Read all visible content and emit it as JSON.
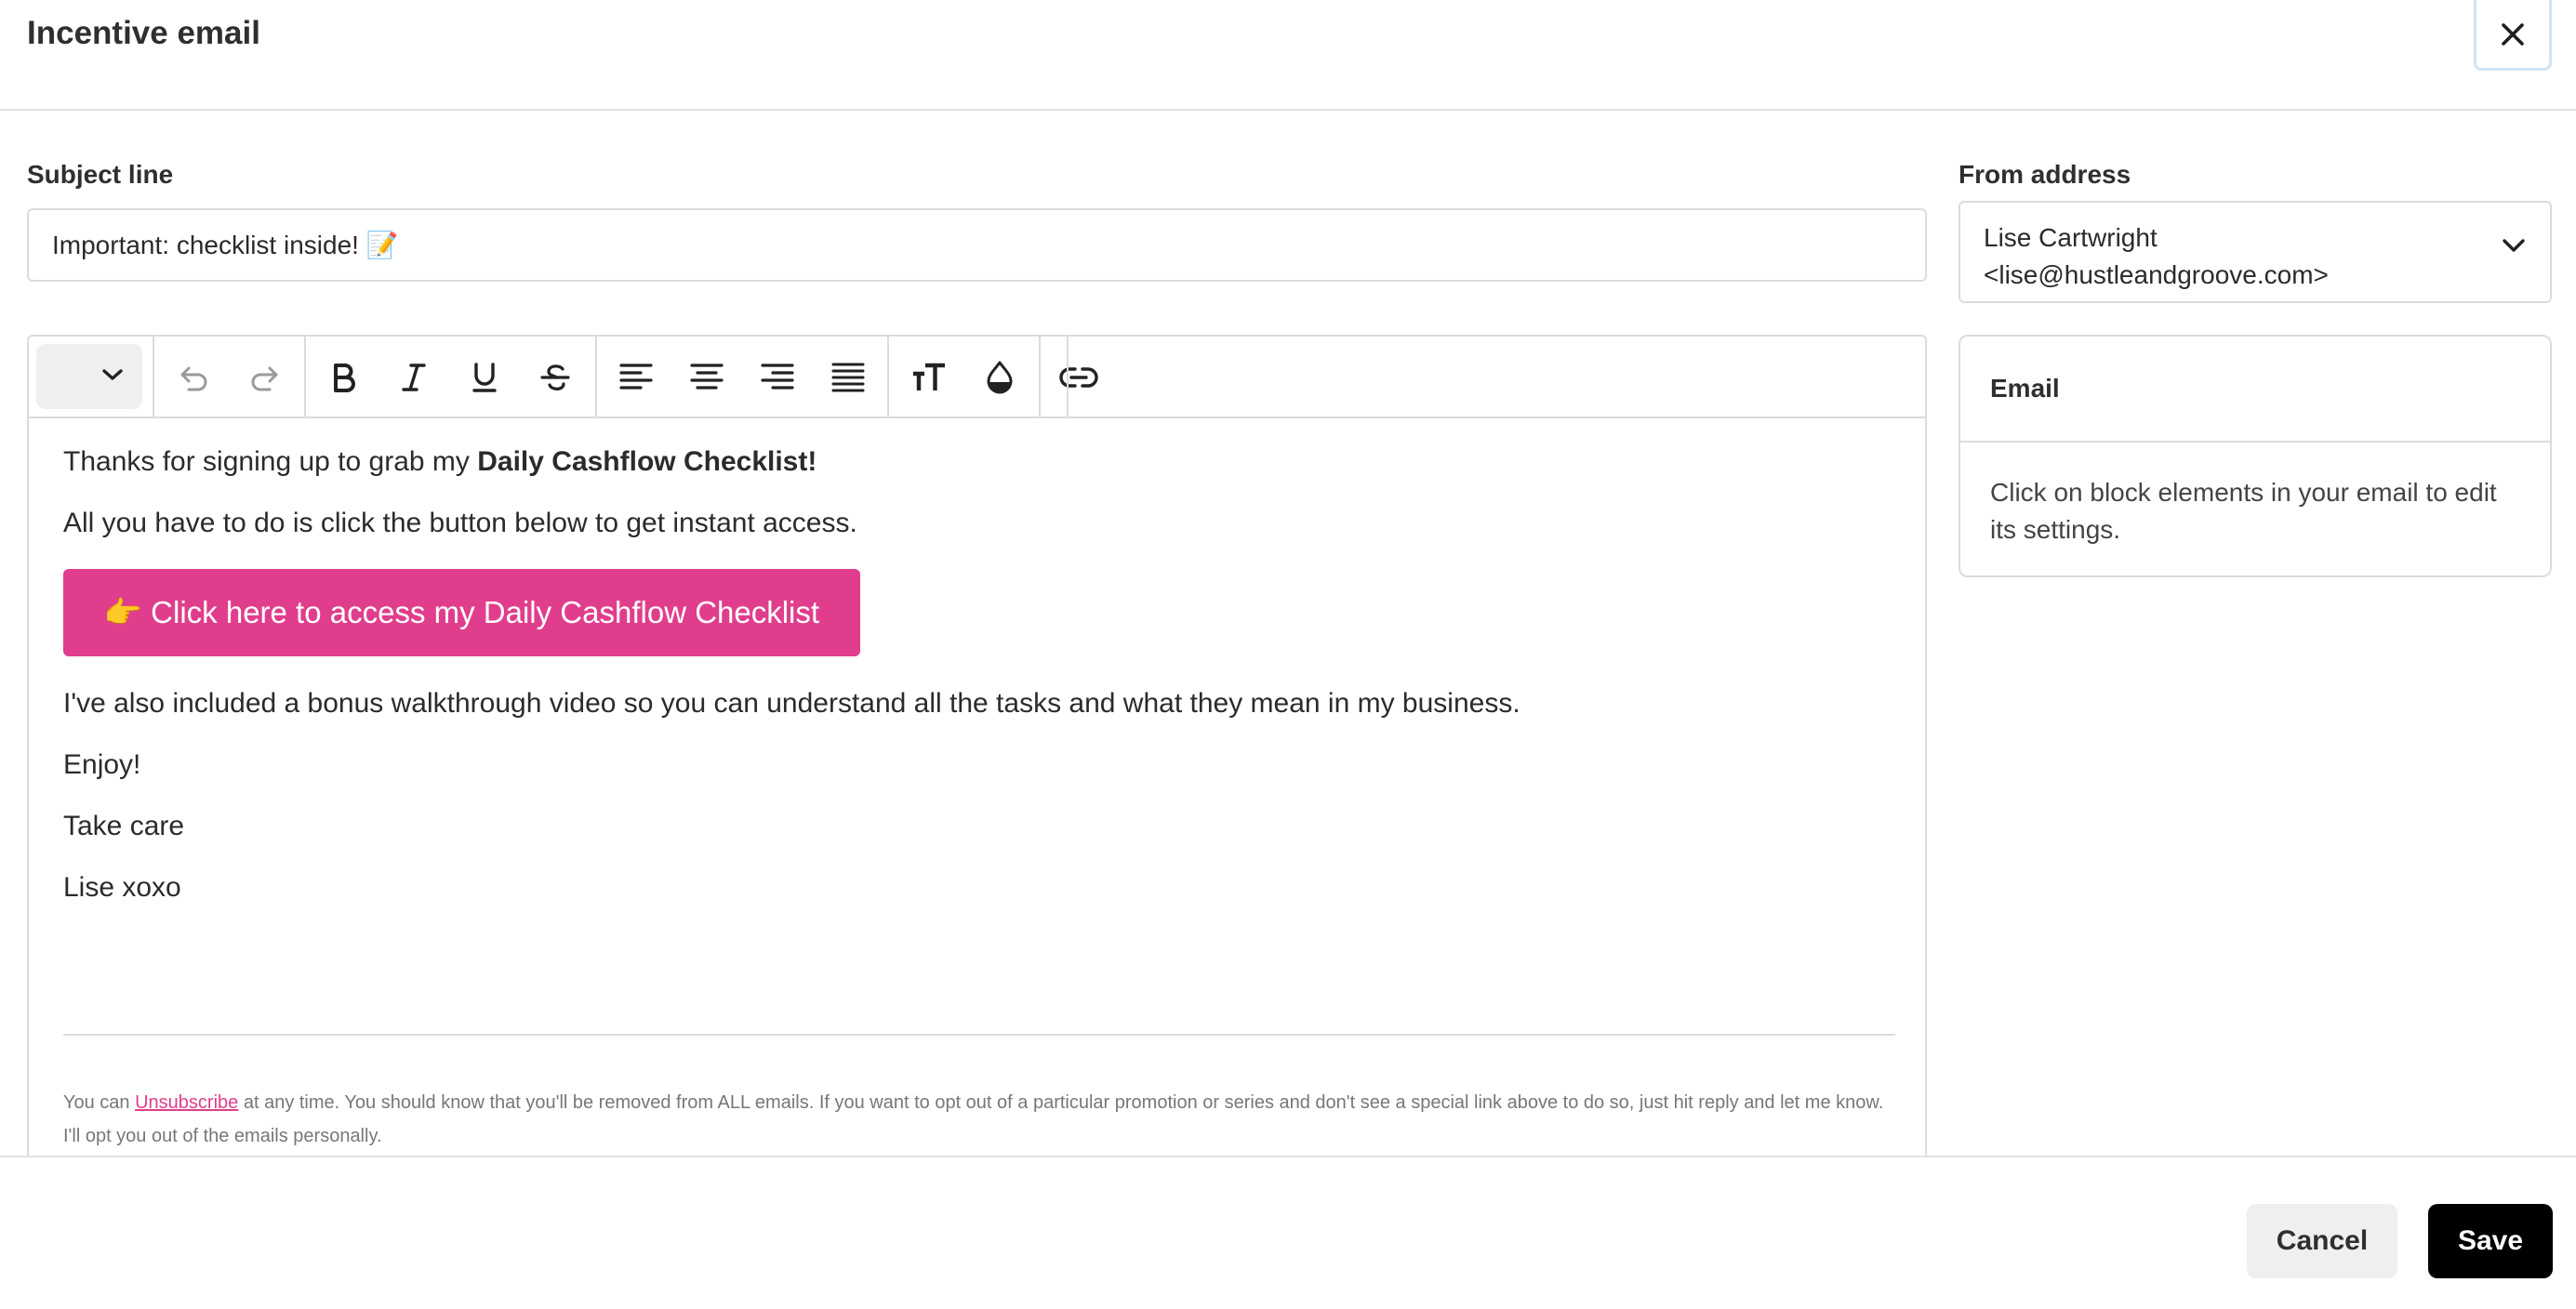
{
  "modal": {
    "title": "Incentive email",
    "close_icon": "close-icon"
  },
  "subject": {
    "label": "Subject line",
    "value": "Important: checklist inside! 📝"
  },
  "from": {
    "label": "From address",
    "name_line": "Lise Cartwright",
    "email_line": "<lise@hustleandgroove.com>",
    "icon": "chevron-down-icon"
  },
  "toolbar": {
    "icons": [
      "chevron-down-icon",
      "undo-icon",
      "redo-icon",
      "bold-icon",
      "italic-icon",
      "underline-icon",
      "strikethrough-icon",
      "align-left-icon",
      "align-center-icon",
      "align-right-icon",
      "align-justify-icon",
      "font-size-icon",
      "color-drop-icon",
      "link-icon"
    ]
  },
  "email_body": {
    "line1_prefix": "Thanks for signing up to grab my ",
    "line1_bold": "Daily Cashflow Checklist!",
    "line2": "All you have to do is click the button below to get instant access.",
    "cta_label": "👉 Click here to access my Daily Cashflow Checklist",
    "line3": "I've also included a bonus walkthrough video so you can understand all the tasks and what they mean in my business.",
    "line4": "Enjoy!",
    "line5": "Take care",
    "line6": "Lise xoxo",
    "footer_prefix": "You can ",
    "footer_link": "Unsubscribe",
    "footer_suffix": " at any time. You should know that you'll be removed from ALL emails. If you want to opt out of a particular promotion or series and don't see a special link above to do so, just hit reply and let me know. I'll opt you out of the emails personally."
  },
  "settings_panel": {
    "title": "Email",
    "description": "Click on block elements in your email to edit its settings."
  },
  "actions": {
    "cancel_label": "Cancel",
    "save_label": "Save"
  },
  "colors": {
    "accent": "#e03e8c",
    "save_bg": "#000000",
    "cancel_bg": "#efefef"
  }
}
